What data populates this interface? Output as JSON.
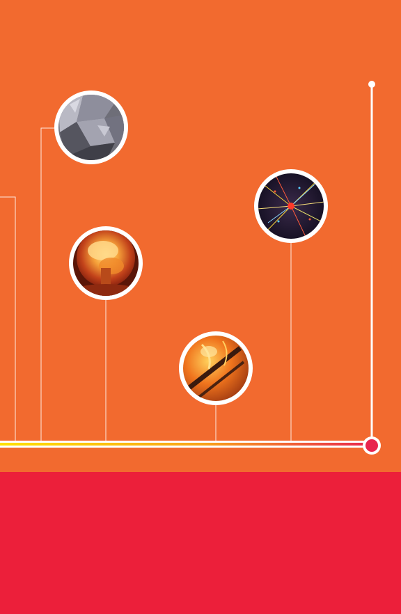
{
  "colors": {
    "background_top": "#F26A2F",
    "background_bottom": "#EC1F3A",
    "line_white": "#FFFFFF",
    "timeline_gradient_start": "#FFE100",
    "timeline_gradient_end": "#E8254E",
    "endpoint_marker": "#E8254E"
  },
  "timeline": {
    "direction": "left-to-right",
    "end_marker_icon": "circle-endpoint-icon",
    "vertical_axis_cap_icon": "dot-cap-icon"
  },
  "milestones": [
    {
      "id": "crystal",
      "image_icon": "crystal-structure-image"
    },
    {
      "id": "explosion",
      "image_icon": "mushroom-cloud-image"
    },
    {
      "id": "fire",
      "image_icon": "fire-image"
    },
    {
      "id": "particles",
      "image_icon": "particle-collision-image"
    }
  ]
}
